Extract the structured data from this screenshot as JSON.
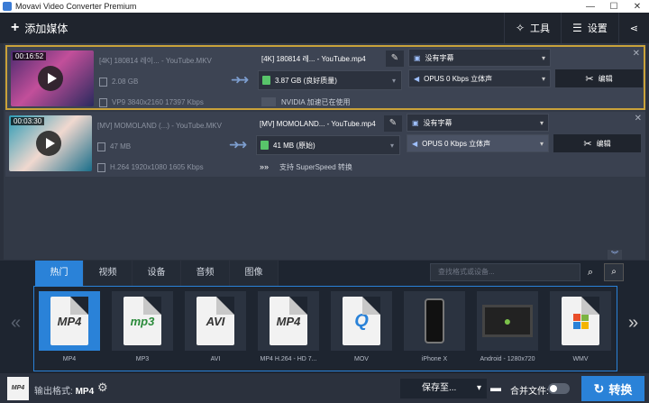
{
  "window": {
    "title": "Movavi Video Converter Premium",
    "controls": [
      "—",
      "☐",
      "✕"
    ]
  },
  "toolbar": {
    "add_media_label": "添加媒体",
    "tools_label": "工具",
    "settings_label": "设置"
  },
  "files": [
    {
      "duration": "00:16:52",
      "source_name": "[4K] 180814 레이... - YouTube.MKV",
      "source_size": "2.08 GB",
      "source_info": "VP9 3840x2160 17397 Kbps",
      "output_name": "[4K] 180814 레... - YouTube.mp4",
      "output_size": "3.87 GB (良好质量)",
      "hw_info": "NVIDIA 加速已在使用",
      "subtitle": "没有字幕",
      "audio": "OPUS 0 Kbps 立体声",
      "edit_label": "编辑",
      "selected": true
    },
    {
      "duration": "00:03:30",
      "source_name": "[MV] MOMOLAND (...) - YouTube.MKV",
      "source_size": "47 MB",
      "source_info": "H.264 1920x1080 1605 Kbps",
      "output_name": "[MV] MOMOLAND... - YouTube.mp4",
      "output_size": "41 MB (原始)",
      "hw_info": "支持 SuperSpeed 转换",
      "subtitle": "没有字幕",
      "audio": "OPUS 0 Kbps 立体声",
      "edit_label": "编辑",
      "selected": false
    }
  ],
  "format_tabs": [
    "热门",
    "视频",
    "设备",
    "音频",
    "图像"
  ],
  "format_search_placeholder": "查找格式或设备...",
  "formats": [
    {
      "label": "MP4",
      "badge": "MP4"
    },
    {
      "label": "MP3",
      "badge": "mp3"
    },
    {
      "label": "AVI",
      "badge": "AVI"
    },
    {
      "label": "MP4 H.264 - HD 7...",
      "badge": "MP4"
    },
    {
      "label": "MOV",
      "badge": "Q"
    },
    {
      "label": "iPhone X",
      "badge": ""
    },
    {
      "label": "Android - 1280x720",
      "badge": ""
    },
    {
      "label": "WMV",
      "badge": ""
    }
  ],
  "bottom": {
    "icon_text": "MP4",
    "output_format_label": "输出格式:",
    "output_format_value": "MP4",
    "save_to_label": "保存至...",
    "merge_label": "合并文件:",
    "convert_label": "转换"
  }
}
